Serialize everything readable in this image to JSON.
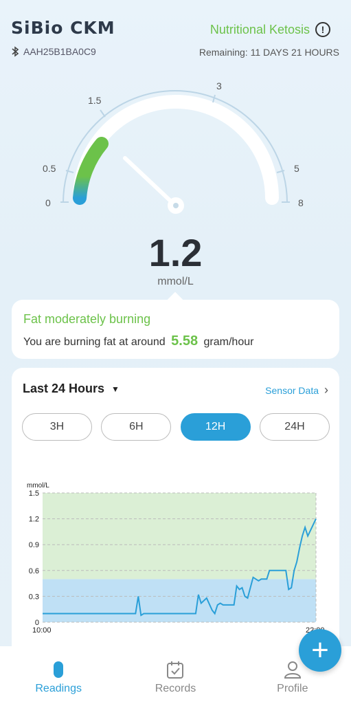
{
  "app": {
    "brand": "SiBio CKM"
  },
  "device": {
    "id": "AAH25B1BA0C9",
    "icon": "bluetooth-icon"
  },
  "status": {
    "label": "Nutritional Ketosis",
    "color": "#6cc24a",
    "icon": "info-icon"
  },
  "remaining": {
    "text": "Remaining:  11 DAYS 21 HOURS"
  },
  "gauge": {
    "ticks": [
      "0",
      "0.5",
      "1.5",
      "3",
      "5",
      "8"
    ],
    "value": 1.2,
    "progress_color": "#6cc24a"
  },
  "reading": {
    "value": "1.2",
    "unit": "mmol/L"
  },
  "fat_card": {
    "title": "Fat moderately burning",
    "text_before": "You are burning fat at around",
    "rate": "5.58",
    "text_after": "gram/hour"
  },
  "history": {
    "range_label": "Last 24 Hours",
    "sensor_link": "Sensor Data",
    "ranges": [
      {
        "label": "3H",
        "active": false
      },
      {
        "label": "6H",
        "active": false
      },
      {
        "label": "12H",
        "active": true
      },
      {
        "label": "24H",
        "active": false
      }
    ]
  },
  "chart_data": {
    "type": "line",
    "ylabel": "mmol/L",
    "ylim": [
      0,
      1.5
    ],
    "yticks": [
      "1.5",
      "1.2",
      "0.9",
      "0.6",
      "0.3",
      "0"
    ],
    "xticks": [
      "10:00",
      "22:00"
    ],
    "bands": [
      {
        "from": 0,
        "to": 0.5,
        "color": "#bfe0f5"
      },
      {
        "from": 0.5,
        "to": 1.5,
        "color": "#dbefd5"
      }
    ],
    "series": [
      {
        "color": "#2a9fd8",
        "x": [
          0,
          0.34,
          0.35,
          0.36,
          0.37,
          0.56,
          0.57,
          0.58,
          0.6,
          0.62,
          0.63,
          0.64,
          0.65,
          0.66,
          0.67,
          0.7,
          0.71,
          0.72,
          0.73,
          0.74,
          0.75,
          0.77,
          0.78,
          0.79,
          0.8,
          0.81,
          0.82,
          0.83,
          0.85,
          0.86,
          0.87,
          0.88,
          0.89,
          0.9,
          0.91,
          0.92,
          0.93,
          0.94,
          0.95,
          0.96,
          0.97,
          1.0
        ],
        "y": [
          0.1,
          0.1,
          0.3,
          0.08,
          0.1,
          0.1,
          0.32,
          0.22,
          0.28,
          0.14,
          0.1,
          0.2,
          0.22,
          0.2,
          0.2,
          0.2,
          0.42,
          0.38,
          0.4,
          0.3,
          0.28,
          0.52,
          0.5,
          0.48,
          0.5,
          0.5,
          0.5,
          0.6,
          0.6,
          0.6,
          0.6,
          0.6,
          0.6,
          0.38,
          0.4,
          0.6,
          0.7,
          0.86,
          1.0,
          1.1,
          1.0,
          1.2
        ]
      }
    ]
  },
  "nav": {
    "items": [
      {
        "label": "Readings",
        "icon": "readings-icon",
        "active": true
      },
      {
        "label": "Records",
        "icon": "calendar-icon",
        "active": false
      },
      {
        "label": "Profile",
        "icon": "profile-icon",
        "active": false
      }
    ]
  },
  "fab": {
    "icon": "plus-icon",
    "label": "+"
  }
}
